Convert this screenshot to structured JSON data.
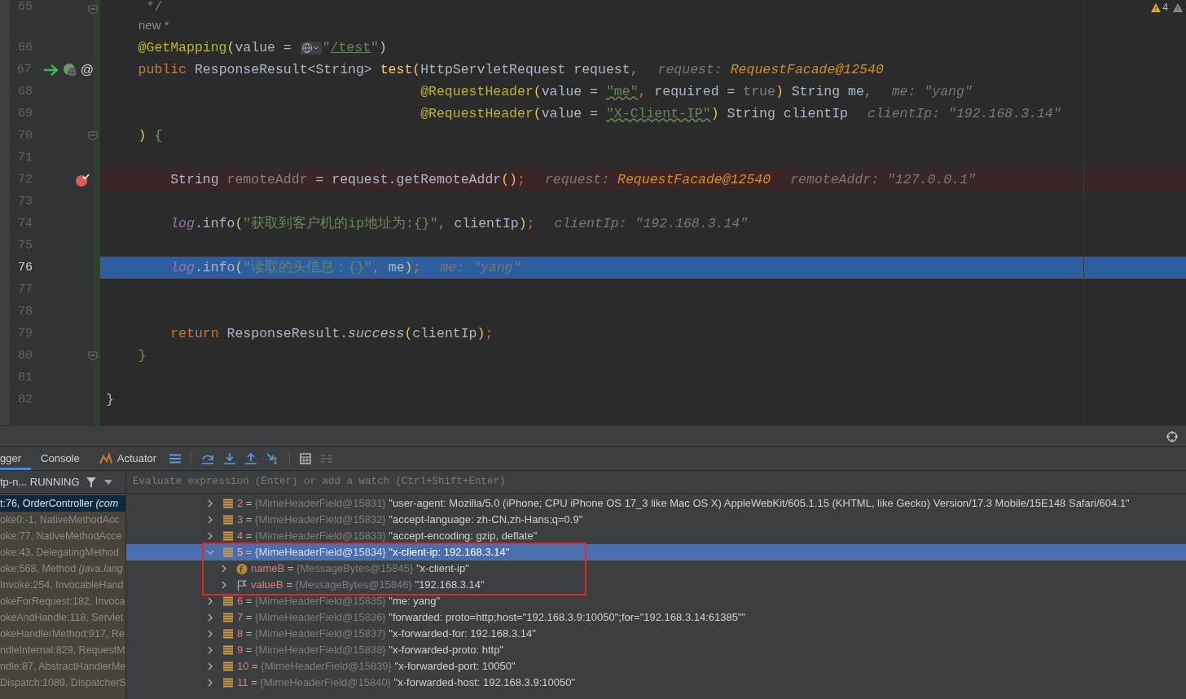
{
  "editor": {
    "warnings": {
      "count": "4"
    },
    "lines": [
      {
        "number": "65",
        "fold": true,
        "tokens": [
          {
            "text": "     */",
            "kind": "comment"
          }
        ]
      },
      {
        "kind": "author",
        "text": "new *"
      },
      {
        "number": "66",
        "tokens": [
          {
            "text": "    @GetMapping",
            "kind": "ann"
          },
          {
            "text": "(",
            "kind": "paren"
          },
          {
            "text": "value = ",
            "kind": "plain"
          },
          {
            "kind": "globe"
          },
          {
            "text": "\"",
            "kind": "str"
          },
          {
            "text": "/test",
            "kind": "link"
          },
          {
            "text": "\"",
            "kind": "str"
          },
          {
            "text": ")",
            "kind": "paren"
          }
        ]
      },
      {
        "number": "67",
        "exec_arrow": true,
        "web_icon": true,
        "annotation": "@",
        "tokens": [
          {
            "text": "    public ",
            "kind": "kw"
          },
          {
            "text": "ResponseResult<String> ",
            "kind": "plain"
          },
          {
            "text": "test",
            "kind": "fn"
          },
          {
            "text": "(",
            "kind": "paren"
          },
          {
            "text": "HttpServletRequest request",
            "kind": "plain"
          },
          {
            "text": ",",
            "kind": "punct"
          }
        ],
        "hints": [
          {
            "label": "request:",
            "value": "RequestFacade@12540",
            "kind": "object"
          }
        ]
      },
      {
        "number": "68",
        "tokens": [
          {
            "text": "                                       @RequestHeader",
            "kind": "ann"
          },
          {
            "text": "(",
            "kind": "paren"
          },
          {
            "text": "value = ",
            "kind": "plain"
          },
          {
            "text": "\"me\"",
            "kind": "typo"
          },
          {
            "text": ", ",
            "kind": "punct"
          },
          {
            "text": "required = ",
            "kind": "plain"
          },
          {
            "text": "true",
            "kind": "dim"
          },
          {
            "text": ")",
            "kind": "paren"
          },
          {
            "text": " String me",
            "kind": "plain"
          },
          {
            "text": ",",
            "kind": "punct"
          }
        ],
        "hints": [
          {
            "label": "me:",
            "value": "\"yang\"",
            "kind": "string"
          }
        ]
      },
      {
        "number": "69",
        "tokens": [
          {
            "text": "                                       @RequestHeader",
            "kind": "ann"
          },
          {
            "text": "(",
            "kind": "paren"
          },
          {
            "text": "value = ",
            "kind": "plain"
          },
          {
            "text": "\"X-Client-IP\"",
            "kind": "typo"
          },
          {
            "text": ")",
            "kind": "paren"
          },
          {
            "text": " String clientIp",
            "kind": "plain"
          }
        ],
        "hints": [
          {
            "label": "clientIp:",
            "value": "\"192.168.3.14\"",
            "kind": "string"
          }
        ]
      },
      {
        "number": "70",
        "fold": true,
        "tokens": [
          {
            "text": "    ) ",
            "kind": "paren"
          },
          {
            "text": "{",
            "kind": "brace"
          }
        ]
      },
      {
        "number": "71"
      },
      {
        "number": "72",
        "breakpoint": true,
        "tokens": [
          {
            "text": "        String ",
            "kind": "plain"
          },
          {
            "text": "remoteAddr",
            "kind": "dim"
          },
          {
            "text": " = request.getRemoteAddr",
            "kind": "plain"
          },
          {
            "text": "()",
            "kind": "paren"
          },
          {
            "text": ";",
            "kind": "punct"
          }
        ],
        "hints": [
          {
            "label": "request:",
            "value": "RequestFacade@12540",
            "kind": "object"
          },
          {
            "label": "remoteAddr:",
            "value": "\"127.0.0.1\"",
            "kind": "string"
          }
        ]
      },
      {
        "number": "73"
      },
      {
        "number": "74",
        "tokens": [
          {
            "text": "        log",
            "kind": "field"
          },
          {
            "text": ".info",
            "kind": "plain"
          },
          {
            "text": "(",
            "kind": "paren"
          },
          {
            "text": "\"获取到客户机的ip地址为:{}\"",
            "kind": "str"
          },
          {
            "text": ", ",
            "kind": "punct"
          },
          {
            "text": "clientIp",
            "kind": "plain"
          },
          {
            "text": ")",
            "kind": "paren"
          },
          {
            "text": ";",
            "kind": "punct"
          }
        ],
        "hints": [
          {
            "label": "clientIp:",
            "value": "\"192.168.3.14\"",
            "kind": "string"
          }
        ]
      },
      {
        "number": "75"
      },
      {
        "number": "76",
        "current": true,
        "tokens": [
          {
            "text": "        log",
            "kind": "field"
          },
          {
            "text": ".info",
            "kind": "plain"
          },
          {
            "text": "(",
            "kind": "paren"
          },
          {
            "text": "\"读取的头信息：{}\"",
            "kind": "str"
          },
          {
            "text": ", ",
            "kind": "punct"
          },
          {
            "text": "me",
            "kind": "plain"
          },
          {
            "text": ")",
            "kind": "paren"
          },
          {
            "text": ";",
            "kind": "punct"
          }
        ],
        "hints": [
          {
            "label": "me:",
            "value": "\"yang\"",
            "kind": "string"
          }
        ]
      },
      {
        "number": "77"
      },
      {
        "number": "78"
      },
      {
        "number": "79",
        "tokens": [
          {
            "text": "        return ",
            "kind": "kw"
          },
          {
            "text": "ResponseResult.",
            "kind": "plain"
          },
          {
            "text": "success",
            "kind": "static"
          },
          {
            "text": "(",
            "kind": "paren"
          },
          {
            "text": "clientIp",
            "kind": "plain"
          },
          {
            "text": ")",
            "kind": "paren"
          },
          {
            "text": ";",
            "kind": "punct"
          }
        ]
      },
      {
        "number": "80",
        "fold": true,
        "tokens": [
          {
            "text": "    }",
            "kind": "brace"
          }
        ]
      },
      {
        "number": "81"
      },
      {
        "number": "82",
        "tokens": [
          {
            "text": "}",
            "kind": "plain"
          }
        ]
      }
    ]
  },
  "debugger": {
    "tabs": [
      {
        "label": "gger",
        "selected": true
      },
      {
        "label": "Console",
        "selected": false
      },
      {
        "label": "Actuator",
        "selected": false
      }
    ],
    "thread": "tp-n... RUNNING",
    "frames": [
      {
        "text": "t:76, OrderController *(com*",
        "selected": true
      },
      {
        "text": "oke0:-1, NativeMethodAcc",
        "selected": false
      },
      {
        "text": "oke:77, NativeMethodAcce",
        "selected": false
      },
      {
        "text": "oke:43, DelegatingMethod",
        "selected": false
      },
      {
        "text": "oke:568, Method *(java.lang*",
        "selected": false
      },
      {
        "text": "Invoke:254, InvocableHand",
        "selected": false
      },
      {
        "text": "okeForRequest:182, Invoca",
        "selected": false
      },
      {
        "text": "okeAndHandle:118, Servlet",
        "selected": false
      },
      {
        "text": "okeHandlerMethod:917, Re",
        "selected": false
      },
      {
        "text": "ndleInternal:829, RequestM",
        "selected": false
      },
      {
        "text": "ndle:87, AbstractHandlerMe",
        "selected": false
      },
      {
        "text": "Dispatch:1089, DispatcherS",
        "selected": false
      }
    ],
    "evaluate": {
      "placeholder": "Evaluate expression (Enter) or add a watch (Ctrl+Shift+Enter)"
    },
    "variables": [
      {
        "kind": "list",
        "name": "2",
        "operator": "=",
        "type": "{MimeHeaderField@15831}",
        "value": "\"user-agent: Mozilla/5.0 (iPhone; CPU iPhone OS 17_3 like Mac OS X) AppleWebKit/605.1.15 (KHTML, like Gecko) Version/17.3 Mobile/15E148 Safari/604.1\"",
        "expanded": false,
        "selected": false
      },
      {
        "kind": "list",
        "name": "3",
        "operator": "=",
        "type": "{MimeHeaderField@15832}",
        "value": "\"accept-language: zh-CN,zh-Hans;q=0.9\"",
        "expanded": false,
        "selected": false
      },
      {
        "kind": "list",
        "name": "4",
        "operator": "=",
        "type": "{MimeHeaderField@15833}",
        "value": "\"accept-encoding: gzip, deflate\"",
        "expanded": false,
        "selected": false
      },
      {
        "kind": "list",
        "name": "5",
        "operator": "=",
        "type": "{MimeHeaderField@15834}",
        "value": "\"x-client-ip: 192.168.3.14\"",
        "expanded": true,
        "selected": true,
        "boxed": true,
        "children": [
          {
            "kind": "field",
            "name": "nameB",
            "operator": "=",
            "type": "{MessageBytes@15845}",
            "value": "\"x-client-ip\"",
            "expanded": false,
            "selected": false
          },
          {
            "kind": "flag",
            "name": "valueB",
            "operator": "=",
            "type": "{MessageBytes@15846}",
            "value": "\"192.168.3.14\"",
            "expanded": false,
            "selected": false
          }
        ]
      },
      {
        "kind": "list",
        "name": "6",
        "operator": "=",
        "type": "{MimeHeaderField@15835}",
        "value": "\"me: yang\"",
        "expanded": false,
        "selected": false
      },
      {
        "kind": "list",
        "name": "7",
        "operator": "=",
        "type": "{MimeHeaderField@15836}",
        "value": "\"forwarded: proto=http;host=\"192.168.3.9:10050\";for=\"192.168.3.14:61385\"\"",
        "expanded": false,
        "selected": false
      },
      {
        "kind": "list",
        "name": "8",
        "operator": "=",
        "type": "{MimeHeaderField@15837}",
        "value": "\"x-forwarded-for: 192.168.3.14\"",
        "expanded": false,
        "selected": false
      },
      {
        "kind": "list",
        "name": "9",
        "operator": "=",
        "type": "{MimeHeaderField@15838}",
        "value": "\"x-forwarded-proto: http\"",
        "expanded": false,
        "selected": false
      },
      {
        "kind": "list",
        "name": "10",
        "operator": "=",
        "type": "{MimeHeaderField@15839}",
        "value": "\"x-forwarded-port: 10050\"",
        "expanded": false,
        "selected": false
      },
      {
        "kind": "list",
        "name": "11",
        "operator": "=",
        "type": "{MimeHeaderField@15840}",
        "value": "\"x-forwarded-host: 192.168.3.9:10050\"",
        "expanded": false,
        "selected": false
      }
    ]
  }
}
